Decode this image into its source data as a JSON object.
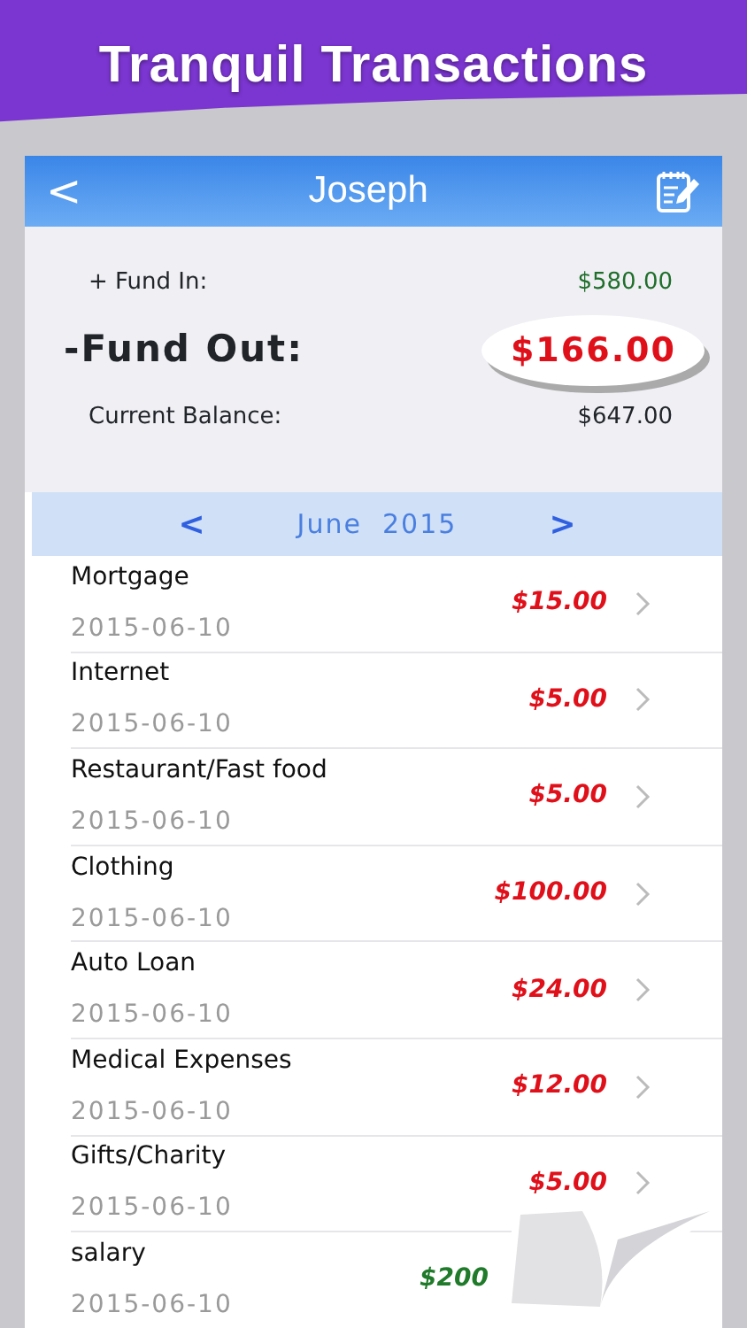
{
  "banner": {
    "title": "Tranquil Transactions"
  },
  "nav": {
    "back": "<",
    "title": "Joseph"
  },
  "summary": {
    "fund_in_label": "+ Fund In:",
    "fund_in": "$580.00",
    "fund_out_label": "-Fund Out:",
    "fund_out": "$166.00",
    "balance_label": "Current Balance:",
    "balance": "$647.00"
  },
  "month": {
    "prev": "<",
    "label": "June  2015",
    "next": ">"
  },
  "transactions": [
    {
      "name": "Mortgage",
      "date": "2015-06-10",
      "amount": "$15.00",
      "color": "#e0101a"
    },
    {
      "name": "Internet",
      "date": "2015-06-10",
      "amount": "$5.00",
      "color": "#e0101a"
    },
    {
      "name": "Restaurant/Fast food",
      "date": "2015-06-10",
      "amount": "$5.00",
      "color": "#e0101a"
    },
    {
      "name": "Clothing",
      "date": "2015-06-10",
      "amount": "$100.00",
      "color": "#e0101a"
    },
    {
      "name": "Auto Loan",
      "date": "2015-06-10",
      "amount": "$24.00",
      "color": "#e0101a"
    },
    {
      "name": "Medical Expenses",
      "date": "2015-06-10",
      "amount": "$12.00",
      "color": "#e0101a"
    },
    {
      "name": "Gifts/Charity",
      "date": "2015-06-10",
      "amount": "$5.00",
      "color": "#e0101a"
    },
    {
      "name": "salary",
      "date": "2015-06-10",
      "amount": "$200",
      "color": "#1f7a2a"
    }
  ]
}
